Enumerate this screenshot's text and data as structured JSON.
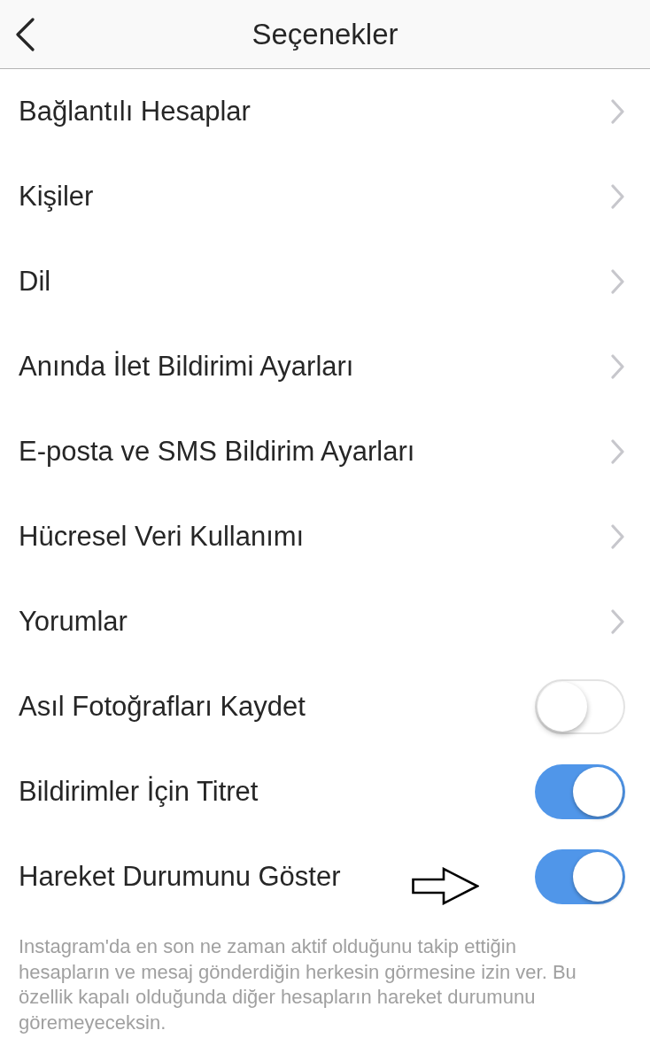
{
  "header": {
    "title": "Seçenekler"
  },
  "menu_items": [
    {
      "label": "Bağlantılı Hesaplar"
    },
    {
      "label": "Kişiler"
    },
    {
      "label": "Dil"
    },
    {
      "label": "Anında İlet Bildirimi Ayarları"
    },
    {
      "label": "E-posta ve SMS Bildirim Ayarları"
    },
    {
      "label": "Hücresel Veri Kullanımı"
    },
    {
      "label": "Yorumlar"
    }
  ],
  "toggles": [
    {
      "label": "Asıl Fotoğrafları Kaydet",
      "on": false,
      "arrow_marker": false
    },
    {
      "label": "Bildirimler İçin Titret",
      "on": true,
      "arrow_marker": false
    },
    {
      "label": "Hareket Durumunu Göster",
      "on": true,
      "arrow_marker": true
    }
  ],
  "footer_note": "Instagram'da en son ne zaman aktif olduğunu takip ettiğin hesapların ve mesaj gönderdiğin herkesin görmesine izin ver. Bu özellik kapalı olduğunda diğer hesapların hareket durumunu göremeyeceksin."
}
